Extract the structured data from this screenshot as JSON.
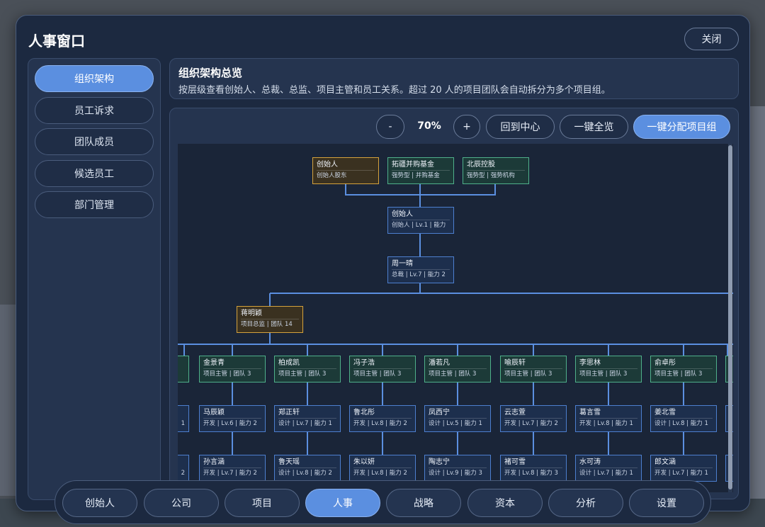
{
  "window": {
    "title": "人事窗口",
    "close_label": "关闭"
  },
  "sidebar": {
    "items": [
      {
        "label": "组织架构",
        "active": true
      },
      {
        "label": "员工诉求"
      },
      {
        "label": "团队成员"
      },
      {
        "label": "候选员工"
      },
      {
        "label": "部门管理"
      }
    ]
  },
  "header": {
    "title": "组织架构总览",
    "description": "按层级查看创始人、总裁、总监、项目主管和员工关系。超过 20 人的项目团队会自动拆分为多个项目组。"
  },
  "toolbar": {
    "zoom_out": "-",
    "zoom_level": "70%",
    "zoom_in": "+",
    "center": "回到中心",
    "overview": "一键全览",
    "assign": "一键分配项目组"
  },
  "org": {
    "shareholders": [
      {
        "name": "创始人",
        "info": "创始人股东",
        "style": "gold"
      },
      {
        "name": "拓疆并购基金",
        "info": "强势型 | 并购基金",
        "style": "green"
      },
      {
        "name": "北辰控股",
        "info": "强势型 | 强势机构",
        "style": "green"
      }
    ],
    "founder": {
      "name": "创始人",
      "info": "创始人 | Lv.1 | 能力"
    },
    "president": {
      "name": "周一晴",
      "info": "总裁 | Lv.7 | 能力 2"
    },
    "director": {
      "name": "蒋明颖",
      "info": "项目总监 | 团队 14"
    },
    "managers": [
      {
        "name": "金景青",
        "info": "项目主管 | 团队 3"
      },
      {
        "name": "柏成凯",
        "info": "项目主管 | 团队 3"
      },
      {
        "name": "冯子浩",
        "info": "项目主管 | 团队 3"
      },
      {
        "name": "潘若凡",
        "info": "项目主管 | 团队 3"
      },
      {
        "name": "喻辰轩",
        "info": "项目主管 | 团队 3"
      },
      {
        "name": "李思林",
        "info": "项目主管 | 团队 3"
      },
      {
        "name": "俞卓彤",
        "info": "项目主管 | 团队 3"
      }
    ],
    "staff_row1": [
      {
        "name": "马辰颖",
        "info": "开发 | Lv.6 | 能力 2"
      },
      {
        "name": "郑正轩",
        "info": "设计 | Lv.7 | 能力 1"
      },
      {
        "name": "鲁北彤",
        "info": "开发 | Lv.8 | 能力 2"
      },
      {
        "name": "凤西宁",
        "info": "设计 | Lv.5 | 能力 1"
      },
      {
        "name": "云志萱",
        "info": "开发 | Lv.7 | 能力 2"
      },
      {
        "name": "葛言雪",
        "info": "开发 | Lv.8 | 能力 1"
      },
      {
        "name": "姜北雪",
        "info": "设计 | Lv.8 | 能力 1"
      }
    ],
    "staff_row2": [
      {
        "name": "孙言涵",
        "info": "开发 | Lv.7 | 能力 2"
      },
      {
        "name": "鲁天瑶",
        "info": "设计 | Lv.8 | 能力 2"
      },
      {
        "name": "朱以妍",
        "info": "开发 | Lv.8 | 能力 2"
      },
      {
        "name": "陶志宁",
        "info": "设计 | Lv.9 | 能力 3"
      },
      {
        "name": "褚可雪",
        "info": "开发 | Lv.8 | 能力 3"
      },
      {
        "name": "水可涛",
        "info": "设计 | Lv.7 | 能力 1"
      },
      {
        "name": "郎文涵",
        "info": "开发 | Lv.7 | 能力 1"
      }
    ],
    "partial_left": {
      "row1_info": "1",
      "row2_info": "2"
    }
  },
  "bottom_nav": [
    {
      "label": "创始人"
    },
    {
      "label": "公司"
    },
    {
      "label": "项目"
    },
    {
      "label": "人事",
      "active": true
    },
    {
      "label": "战略"
    },
    {
      "label": "资本"
    },
    {
      "label": "分析"
    },
    {
      "label": "设置"
    }
  ]
}
